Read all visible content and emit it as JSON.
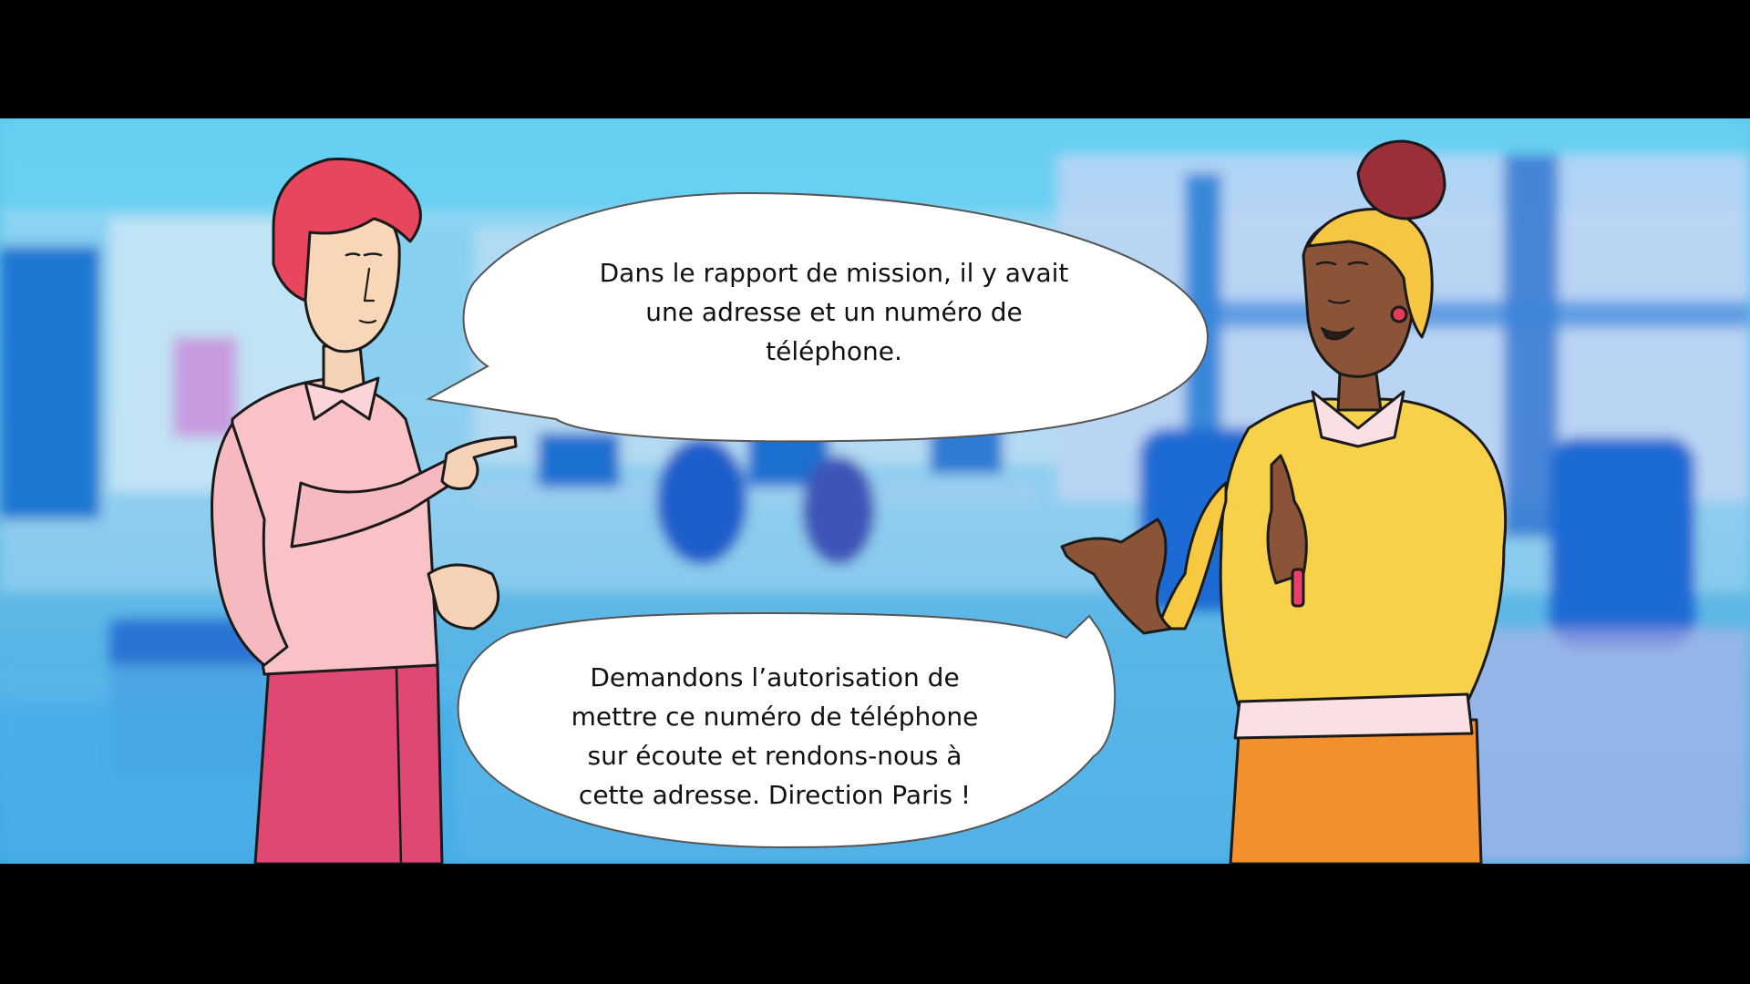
{
  "dialogue": {
    "bubble1": "Dans le rapport de mission, il y avait\nune adresse et un numéro de\ntéléphone.",
    "bubble2": "Demandons l’autorisation  de\nmettre ce numéro de téléphone\nsur écoute et rendons-nous à\ncette adresse. Direction Paris !"
  },
  "characters": [
    {
      "role": "speaker-left",
      "hair": "red",
      "outfit": "pink shirt, magenta trousers"
    },
    {
      "role": "speaker-right",
      "hair": "yellow headscarf, burgundy bun",
      "outfit": "yellow sweater, orange trousers"
    }
  ],
  "colors": {
    "letterbox": "#000000",
    "background_blue": "#4db3e6",
    "bubble_fill": "#ffffff",
    "bubble_stroke": "#555555"
  }
}
